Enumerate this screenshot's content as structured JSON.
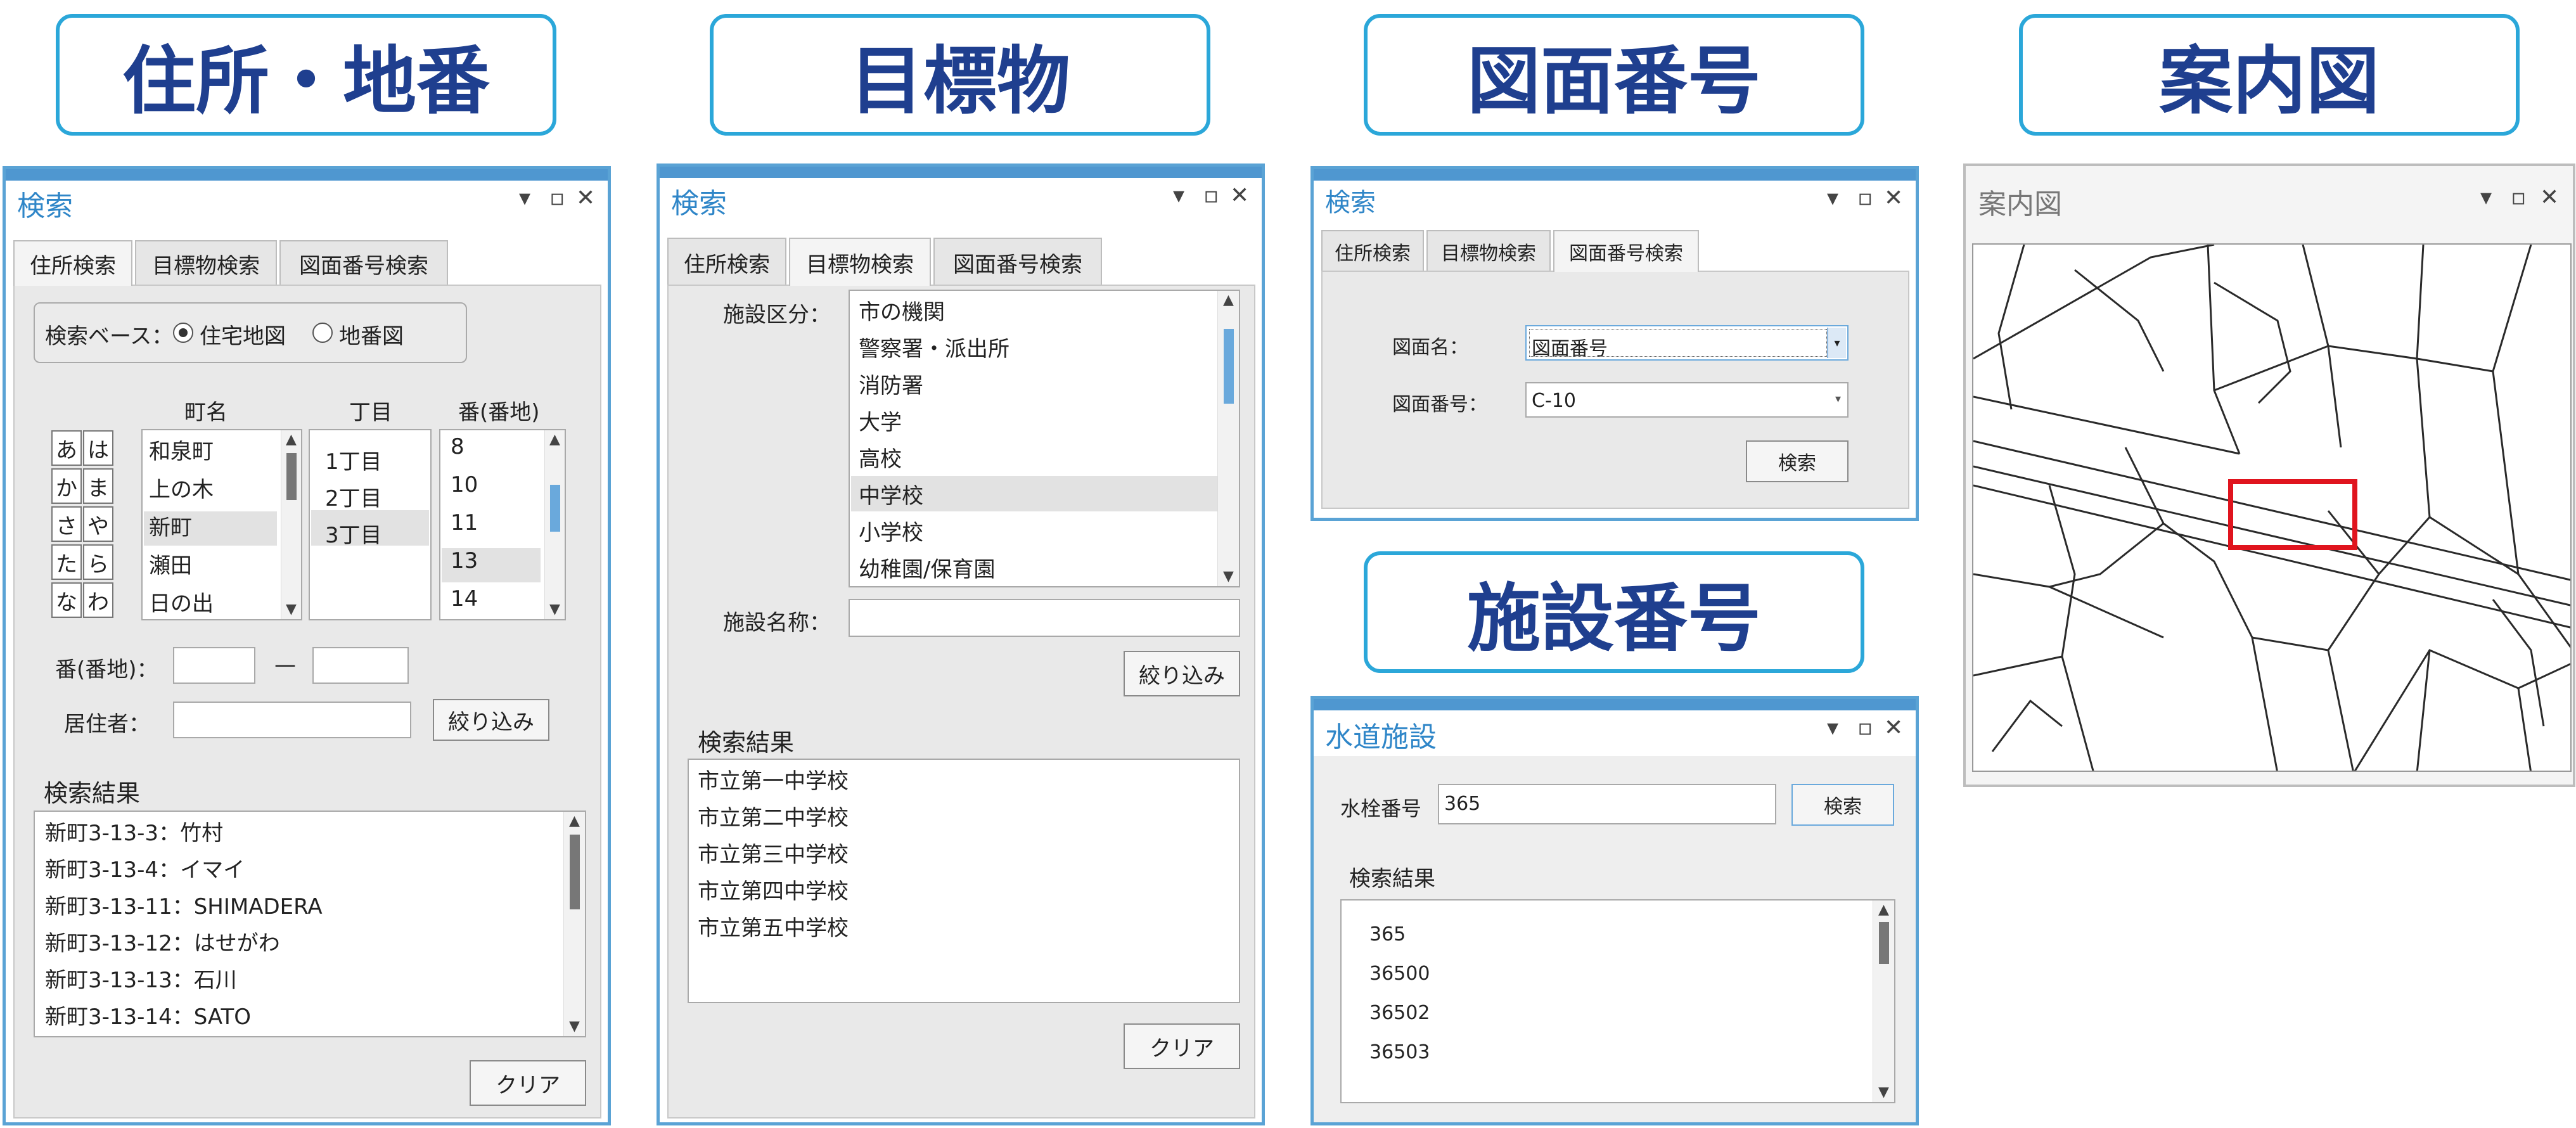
{
  "headers": {
    "h1": "住所・地番",
    "h2": "目標物",
    "h3": "図面番号",
    "h4": "案内図",
    "h5": "施設番号"
  },
  "window_controls": {
    "menu": "▾",
    "max": "▫",
    "close": "✕"
  },
  "address_panel": {
    "title": "検索",
    "tabs": [
      "住所検索",
      "目標物検索",
      "図面番号検索"
    ],
    "base_label": "検索ベース：",
    "radio_options": [
      "住宅地図",
      "地番図"
    ],
    "col_town": "町名",
    "col_chome": "丁目",
    "col_number": "番(番地)",
    "kana": [
      "あ",
      "は",
      "か",
      "ま",
      "さ",
      "や",
      "た",
      "ら",
      "な",
      "わ"
    ],
    "towns": [
      "和泉町",
      "上の木",
      "新町",
      "瀬田",
      "日の出"
    ],
    "chome": [
      "1丁目",
      "2丁目",
      "3丁目"
    ],
    "numbers": [
      "8",
      "10",
      "11",
      "13",
      "14"
    ],
    "number_label": "番(番地)：",
    "dash": "—",
    "resident_label": "居住者：",
    "filter_button": "絞り込み",
    "results_label": "検索結果",
    "results": [
      "新町3-13-3：竹村",
      "新町3-13-4：イマイ",
      "新町3-13-11：SHIMADERA",
      "新町3-13-12：はせがわ",
      "新町3-13-13：石川",
      "新町3-13-14：SATO"
    ],
    "clear_button": "クリア"
  },
  "landmark_panel": {
    "title": "検索",
    "tabs": [
      "住所検索",
      "目標物検索",
      "図面番号検索"
    ],
    "category_label": "施設区分：",
    "categories": [
      "市の機関",
      "警察署・派出所",
      "消防署",
      "大学",
      "高校",
      "中学校",
      "小学校",
      "幼稚園/保育園"
    ],
    "name_label": "施設名称：",
    "name_value": "",
    "filter_button": "絞り込み",
    "results_label": "検索結果",
    "results": [
      "市立第一中学校",
      "市立第二中学校",
      "市立第三中学校",
      "市立第四中学校",
      "市立第五中学校"
    ],
    "clear_button": "クリア"
  },
  "drawing_panel": {
    "title": "検索",
    "tabs": [
      "住所検索",
      "目標物検索",
      "図面番号検索"
    ],
    "name_label": "図面名：",
    "name_value": "図面番号",
    "number_label": "図面番号：",
    "number_value": "C-10",
    "search_button": "検索"
  },
  "facility_panel": {
    "title": "水道施設",
    "hydrant_label": "水栓番号",
    "hydrant_value": "365",
    "search_button": "検索",
    "results_label": "検索結果",
    "results": [
      "365",
      "36500",
      "36502",
      "36503"
    ]
  },
  "guide_panel": {
    "title": "案内図"
  }
}
